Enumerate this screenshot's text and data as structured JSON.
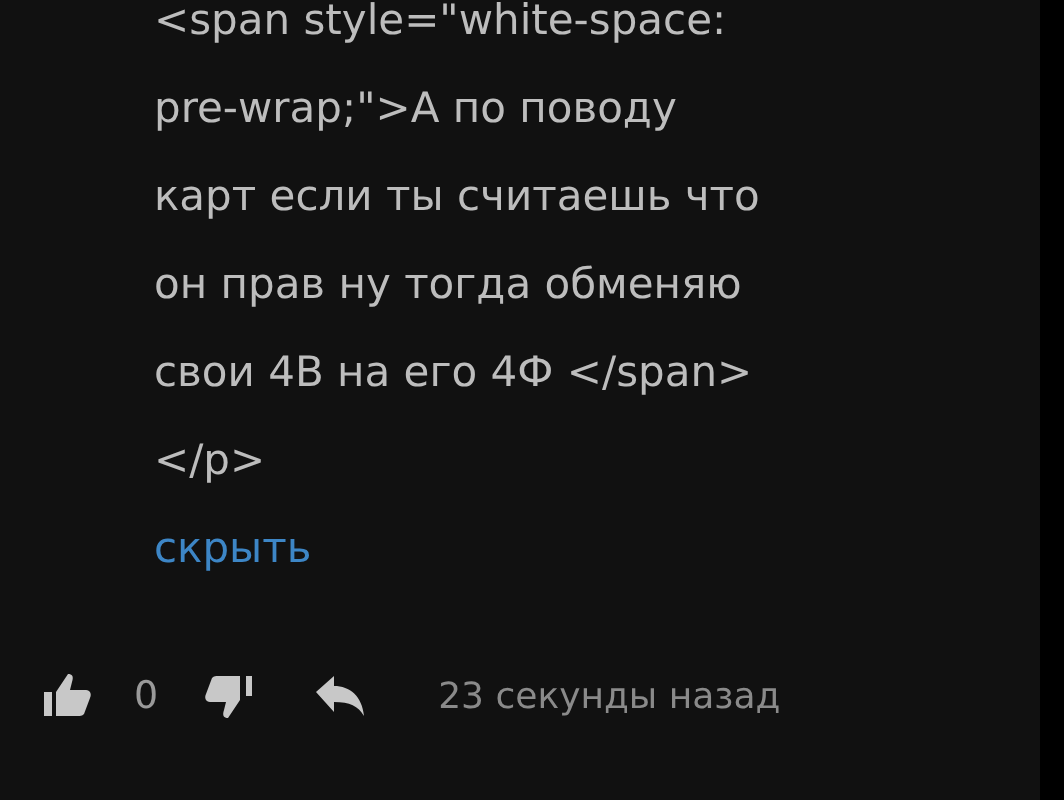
{
  "comment": {
    "lines": [
      "<span style=\"white-space:",
      "pre-wrap;\">А по поводу",
      "карт если ты считаешь что",
      "он прав ну тогда обменяю",
      "свои 4В на его 4Ф </span>",
      "</p>"
    ],
    "toggle_link": "скрыть",
    "likes": "0",
    "time": "23 секунды назад"
  }
}
